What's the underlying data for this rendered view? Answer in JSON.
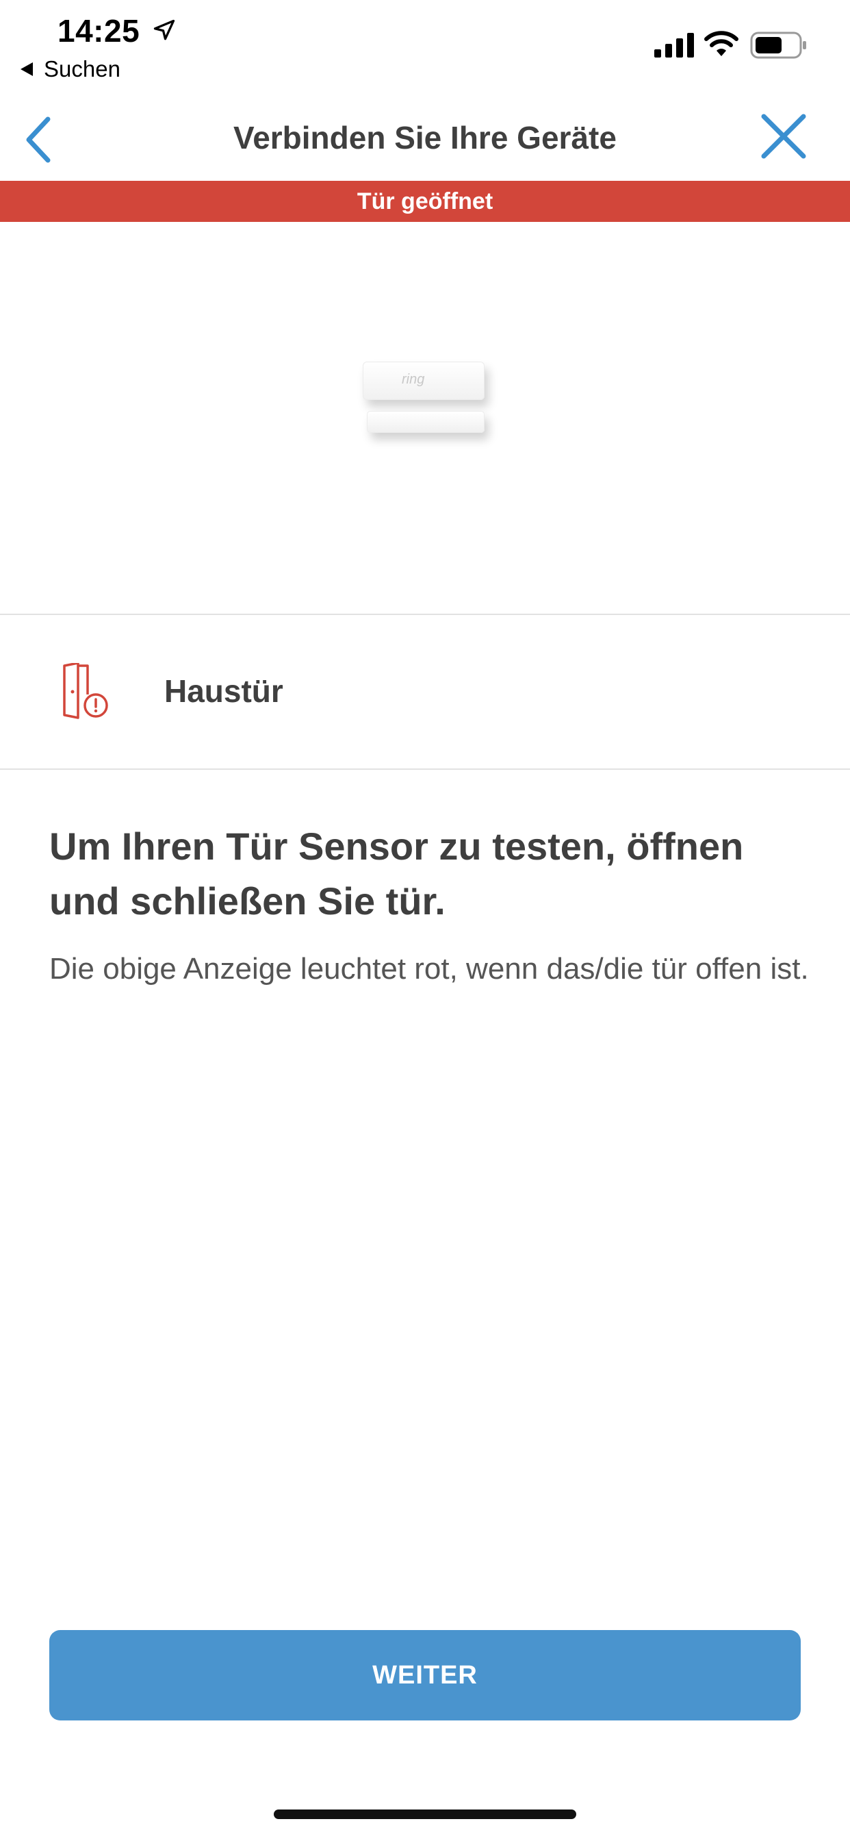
{
  "status_bar": {
    "time": "14:25",
    "back_app": "Suchen",
    "icons": [
      "location-arrow-icon",
      "signal-icon",
      "wifi-icon",
      "battery-icon"
    ]
  },
  "nav": {
    "title": "Verbinden Sie Ihre Geräte",
    "back_icon": "chevron-left-icon",
    "close_icon": "close-icon"
  },
  "alert": {
    "text": "Tür geöffnet",
    "color": "#d2463a"
  },
  "device_image": {
    "logo_text": "ring"
  },
  "device": {
    "name": "Haustür",
    "icon": "door-alert-icon"
  },
  "instruction": {
    "heading": "Um Ihren Tür Sensor zu testen, öffnen und schließen Sie tür.",
    "body": "Die obige Anzeige leuchtet rot, wenn das/die tür offen ist."
  },
  "button": {
    "label": "WEITER",
    "color": "#4a94ce"
  },
  "colors": {
    "accent": "#3a8fd0",
    "alert": "#d2463a",
    "text": "#3f3f3f"
  }
}
